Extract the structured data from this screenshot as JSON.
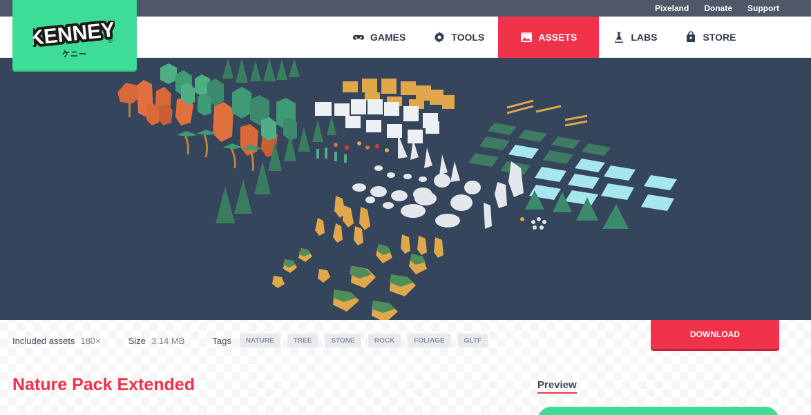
{
  "brand": {
    "logo_text": "KENNEY",
    "logo_sub": "ケニー",
    "registered": "®",
    "color": "#3ddc97"
  },
  "top_links": [
    "Pixeland",
    "Donate",
    "Support"
  ],
  "nav": [
    {
      "label": "GAMES",
      "icon": "gamepad-icon",
      "active": false
    },
    {
      "label": "TOOLS",
      "icon": "gear-icon",
      "active": false
    },
    {
      "label": "ASSETS",
      "icon": "image-icon",
      "active": true
    },
    {
      "label": "LABS",
      "icon": "flask-icon",
      "active": false
    },
    {
      "label": "STORE",
      "icon": "shopping-bag-icon",
      "active": false
    }
  ],
  "accent_color": "#f0324a",
  "hero": {
    "background": "#34455c",
    "image": "nature-assets-preview"
  },
  "info": {
    "included_label": "Included assets",
    "included_value": "180×",
    "size_label": "Size",
    "size_value": "3.14 MB",
    "tags_label": "Tags",
    "tags": [
      "NATURE",
      "TREE",
      "STONE",
      "ROCK",
      "FOLIAGE",
      "GLTF"
    ]
  },
  "download_label": "DOWNLOAD",
  "title": "Nature Pack Extended",
  "preview_label": "Preview"
}
